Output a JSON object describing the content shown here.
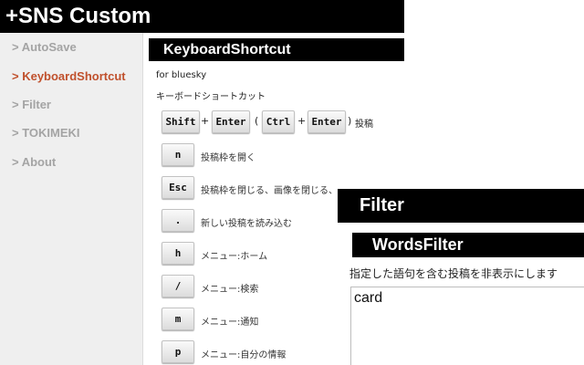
{
  "header": {
    "title": "+SNS Custom"
  },
  "sidebar": {
    "items": [
      {
        "label": "> AutoSave"
      },
      {
        "label": "> KeyboardShortcut"
      },
      {
        "label": "> Filter"
      },
      {
        "label": "> TOKIMEKI"
      },
      {
        "label": "> About"
      }
    ]
  },
  "keyboard": {
    "heading": "KeyboardShortcut",
    "subtitle": "for bluesky",
    "section_label": "キーボードショートカット",
    "combo": {
      "key1": "Shift",
      "plus1": "+",
      "key2": "Enter",
      "paren_open": "(",
      "key3": "Ctrl",
      "plus2": "+",
      "key4": "Enter",
      "paren_close": ")",
      "desc": "投稿"
    },
    "shortcuts": [
      {
        "key": "n",
        "desc": "投稿枠を開く"
      },
      {
        "key": "Esc",
        "desc": "投稿枠を閉じる、画像を閉じる、"
      },
      {
        "key": ".",
        "desc": "新しい投稿を読み込む"
      },
      {
        "key": "h",
        "desc": "メニュー:ホーム"
      },
      {
        "key": "/",
        "desc": "メニュー:検索"
      },
      {
        "key": "m",
        "desc": "メニュー:通知"
      },
      {
        "key": "p",
        "desc": "メニュー:自分の情報"
      }
    ]
  },
  "filter": {
    "heading": "Filter",
    "subheading": "WordsFilter",
    "description": "指定した語句を含む投稿を非表示にします",
    "words_value": "card"
  },
  "colors": {
    "active": "#c0512d",
    "inactive": "#a4a4a4",
    "header_bg": "#000000"
  }
}
